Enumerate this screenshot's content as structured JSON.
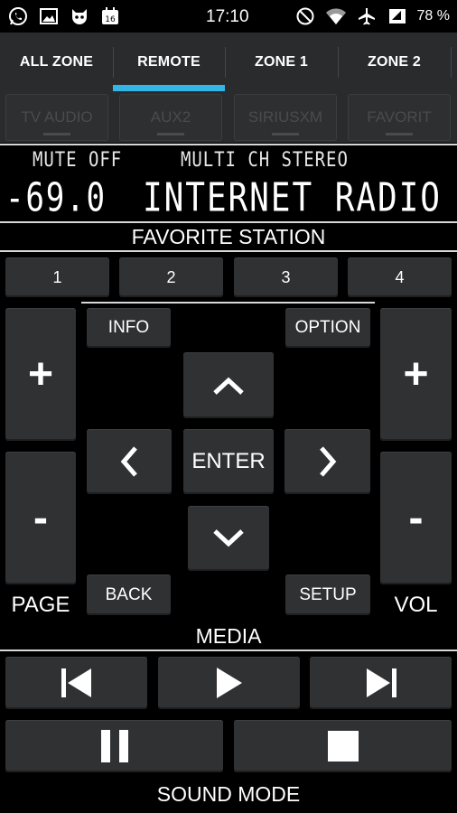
{
  "status_bar": {
    "time": "17:10",
    "battery": "78 %",
    "left_icons": [
      "whatsapp-icon",
      "image-icon",
      "cat-icon",
      "calendar-icon"
    ],
    "calendar_day": "16",
    "right_icons": [
      "do-not-disturb-icon",
      "wifi-icon",
      "airplane-icon",
      "data-saver-icon"
    ]
  },
  "tabs": [
    {
      "label": "ALL ZONE"
    },
    {
      "label": "REMOTE"
    },
    {
      "label": "ZONE 1"
    },
    {
      "label": "ZONE 2"
    }
  ],
  "active_tab": "REMOTE",
  "inputs": [
    {
      "label": "TV AUDIO"
    },
    {
      "label": "AUX2"
    },
    {
      "label": "SIRIUSXM"
    },
    {
      "label": "FAVORIT"
    }
  ],
  "display": {
    "mute": "MUTE OFF",
    "surround": "MULTI CH STEREO",
    "volume": "-69.0",
    "source": "INTERNET RADIO"
  },
  "favorite": {
    "title": "FAVORITE STATION",
    "buttons": [
      "1",
      "2",
      "3",
      "4"
    ]
  },
  "nav": {
    "info": "INFO",
    "option": "OPTION",
    "enter": "ENTER",
    "back": "BACK",
    "setup": "SETUP"
  },
  "page": {
    "label": "PAGE",
    "plus": "+",
    "minus": "-"
  },
  "vol": {
    "label": "VOL",
    "plus": "+",
    "minus": "-"
  },
  "media": {
    "title": "MEDIA"
  },
  "sound_mode": {
    "title": "SOUND MODE"
  },
  "colors": {
    "accent": "#33b5e5",
    "button": "#2f3133",
    "background": "#000000",
    "bar": "#2a2b2d"
  }
}
